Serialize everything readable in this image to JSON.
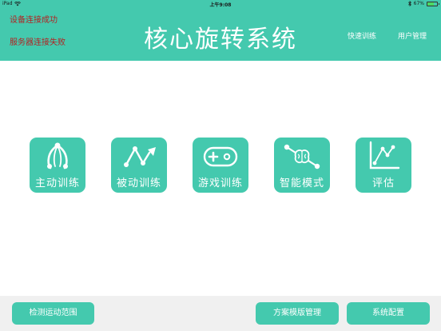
{
  "statusbar": {
    "device": "iPad",
    "time": "上午9:08",
    "battery": "67%",
    "battery_level": 0.67
  },
  "header": {
    "device_status": "设备连接成功",
    "server_status": "服务器连接失败",
    "title": "核心旋转系统",
    "quick_training": "快速训练",
    "user_management": "用户管理"
  },
  "tiles": [
    {
      "label": "主动训练",
      "icon": "active-training-icon"
    },
    {
      "label": "被动训练",
      "icon": "passive-training-icon"
    },
    {
      "label": "游戏训练",
      "icon": "gamepad-icon"
    },
    {
      "label": "智能模式",
      "icon": "brain-icon"
    },
    {
      "label": "评估",
      "icon": "line-chart-icon"
    }
  ],
  "footer": {
    "range_detection": "检测运动范围",
    "plan_template": "方案模版管理",
    "system_config": "系统配置"
  },
  "colors": {
    "accent": "#44c9ae",
    "status_text": "#b22222",
    "footer_bg": "#f0f0f0"
  }
}
